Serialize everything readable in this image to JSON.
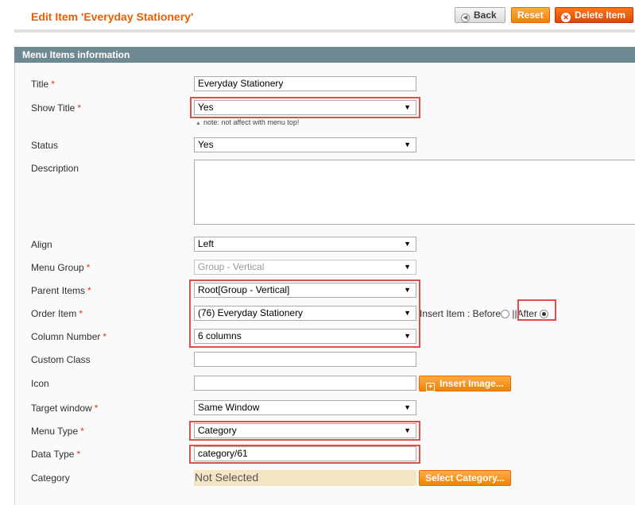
{
  "header": {
    "title": "Edit Item 'Everyday Stationery'",
    "back_label": "Back",
    "reset_label": "Reset",
    "delete_label": "Delete Item"
  },
  "section": {
    "title": "Menu Items information"
  },
  "form": {
    "title": {
      "label": "Title",
      "value": "Everyday Stationery"
    },
    "show_title": {
      "label": "Show Title",
      "value": "Yes",
      "note": "note: not affect with menu top!"
    },
    "status": {
      "label": "Status",
      "value": "Yes"
    },
    "description": {
      "label": "Description",
      "value": ""
    },
    "align": {
      "label": "Align",
      "value": "Left"
    },
    "menu_group": {
      "label": "Menu Group",
      "value": "Group - Vertical"
    },
    "parent_items": {
      "label": "Parent Items",
      "value": "Root[Group - Vertical]"
    },
    "order_item": {
      "label": "Order Item",
      "value": "(76) Everyday Stationery",
      "insert_label": "Insert Item : Before",
      "separator": "||",
      "after_label": "After"
    },
    "column_number": {
      "label": "Column Number",
      "value": "6 columns"
    },
    "custom_class": {
      "label": "Custom Class",
      "value": ""
    },
    "icon": {
      "label": "Icon",
      "value": "",
      "button_label": "Insert Image..."
    },
    "target_window": {
      "label": "Target window",
      "value": "Same Window"
    },
    "menu_type": {
      "label": "Menu Type",
      "value": "Category"
    },
    "data_type": {
      "label": "Data Type",
      "value": "category/61"
    },
    "category": {
      "label": "Category",
      "value": "Not Selected",
      "button_label": "Select Category..."
    }
  },
  "icons": {
    "back": "back-arrow-icon",
    "delete": "delete-x-icon",
    "dropdown": "dropdown-arrow-icon",
    "image": "image-icon"
  },
  "colors": {
    "title_orange": "#eb5e00",
    "section_header": "#6f8992",
    "orange_button": "#f18200",
    "required_star": "#eb340a",
    "highlight_box": "#e04d4d",
    "not_selected_bg": "#f4e6c4"
  }
}
